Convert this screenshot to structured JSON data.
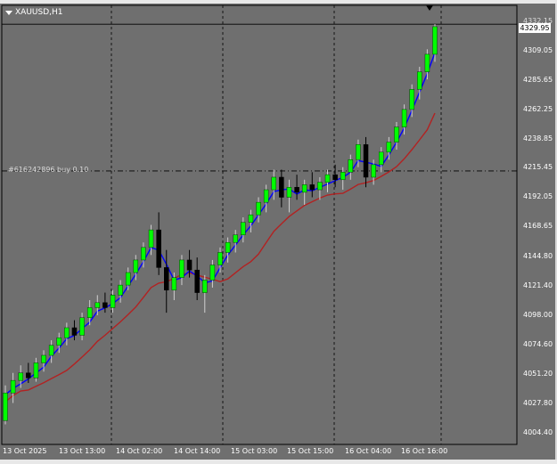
{
  "window": {
    "symbol_label": "XAUUSD,H1",
    "order_line_label": "#616242896 buy 0.10",
    "current_price": "4329.95"
  },
  "colors": {
    "chart_background": "#6f6f6f",
    "bull_candle": "#00ff00",
    "bear_candle": "#000000",
    "fast_ma": "#0000ff",
    "slow_ma": "#b22222",
    "grid": "#000000"
  },
  "chart_data": {
    "type": "candlestick",
    "x_tick_labels": [
      "13 Oct 2025",
      "13 Oct 13:00",
      "14 Oct 02:00",
      "14 Oct 14:00",
      "15 Oct 03:00",
      "15 Oct 15:00",
      "16 Oct 04:00",
      "16 Oct 16:00"
    ],
    "y_tick_labels": [
      "4332.15",
      "4309.05",
      "4285.65",
      "4262.25",
      "4238.85",
      "4215.45",
      "4192.05",
      "4168.65",
      "4144.80",
      "4121.40",
      "4098.00",
      "4074.60",
      "4051.20",
      "4027.80",
      "4004.40"
    ],
    "ylim": [
      3995,
      4345
    ],
    "order_line_price": 4213,
    "current_price_value": 4329.95,
    "grid": true,
    "series": [
      {
        "name": "",
        "kind": "ma_fast",
        "color": "#0000ff"
      },
      {
        "name": "",
        "kind": "ma_slow",
        "color": "#b22222"
      }
    ],
    "ohlc": [
      [
        4014,
        4042,
        4011,
        4036
      ],
      [
        4036,
        4052,
        4028,
        4046
      ],
      [
        4046,
        4058,
        4040,
        4052
      ],
      [
        4052,
        4060,
        4044,
        4048
      ],
      [
        4048,
        4064,
        4045,
        4060
      ],
      [
        4060,
        4070,
        4053,
        4066
      ],
      [
        4066,
        4078,
        4060,
        4074
      ],
      [
        4074,
        4084,
        4068,
        4080
      ],
      [
        4080,
        4092,
        4074,
        4088
      ],
      [
        4088,
        4094,
        4078,
        4082
      ],
      [
        4082,
        4100,
        4078,
        4096
      ],
      [
        4096,
        4110,
        4090,
        4104
      ],
      [
        4104,
        4114,
        4098,
        4108
      ],
      [
        4108,
        4116,
        4100,
        4104
      ],
      [
        4104,
        4118,
        4100,
        4114
      ],
      [
        4114,
        4126,
        4108,
        4122
      ],
      [
        4122,
        4136,
        4118,
        4132
      ],
      [
        4132,
        4146,
        4126,
        4142
      ],
      [
        4142,
        4156,
        4136,
        4152
      ],
      [
        4152,
        4170,
        4146,
        4166
      ],
      [
        4166,
        4180,
        4130,
        4136
      ],
      [
        4136,
        4150,
        4100,
        4118
      ],
      [
        4118,
        4132,
        4110,
        4128
      ],
      [
        4128,
        4146,
        4122,
        4142
      ],
      [
        4142,
        4150,
        4128,
        4134
      ],
      [
        4134,
        4144,
        4110,
        4116
      ],
      [
        4116,
        4130,
        4100,
        4126
      ],
      [
        4126,
        4142,
        4120,
        4138
      ],
      [
        4138,
        4152,
        4132,
        4148
      ],
      [
        4148,
        4160,
        4140,
        4156
      ],
      [
        4156,
        4166,
        4148,
        4162
      ],
      [
        4162,
        4176,
        4156,
        4172
      ],
      [
        4172,
        4182,
        4164,
        4178
      ],
      [
        4178,
        4192,
        4172,
        4188
      ],
      [
        4188,
        4202,
        4180,
        4198
      ],
      [
        4198,
        4214,
        4190,
        4208
      ],
      [
        4208,
        4214,
        4184,
        4192
      ],
      [
        4192,
        4206,
        4180,
        4200
      ],
      [
        4200,
        4210,
        4190,
        4196
      ],
      [
        4196,
        4206,
        4186,
        4202
      ],
      [
        4202,
        4212,
        4192,
        4198
      ],
      [
        4198,
        4208,
        4190,
        4204
      ],
      [
        4204,
        4214,
        4196,
        4210
      ],
      [
        4210,
        4218,
        4200,
        4206
      ],
      [
        4206,
        4216,
        4198,
        4212
      ],
      [
        4212,
        4226,
        4206,
        4222
      ],
      [
        4222,
        4238,
        4216,
        4234
      ],
      [
        4234,
        4240,
        4200,
        4208
      ],
      [
        4208,
        4222,
        4202,
        4218
      ],
      [
        4218,
        4232,
        4212,
        4228
      ],
      [
        4228,
        4240,
        4222,
        4236
      ],
      [
        4236,
        4252,
        4230,
        4248
      ],
      [
        4248,
        4266,
        4242,
        4262
      ],
      [
        4262,
        4282,
        4256,
        4278
      ],
      [
        4278,
        4296,
        4270,
        4292
      ],
      [
        4292,
        4310,
        4286,
        4306
      ],
      [
        4306,
        4330,
        4300,
        4328
      ]
    ]
  }
}
